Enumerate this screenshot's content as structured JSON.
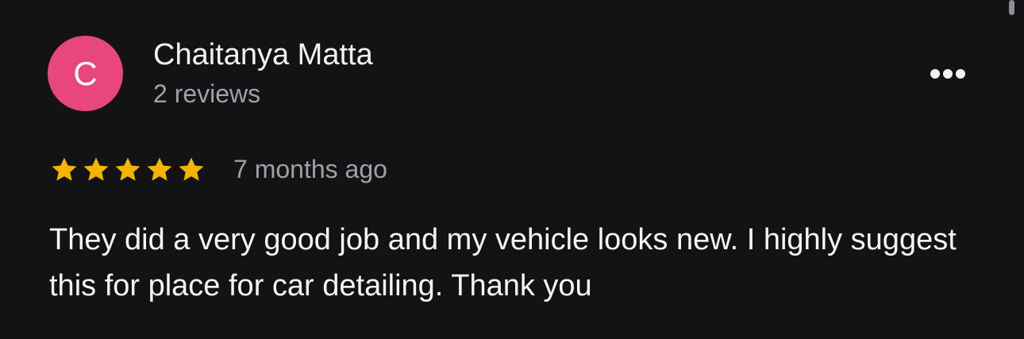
{
  "review": {
    "avatar_initial": "C",
    "author_name": "Chaitanya Matta",
    "author_review_count": "2 reviews",
    "rating": 5,
    "rating_max": 5,
    "timestamp": "7 months ago",
    "text": "They did a very good job and my vehicle looks new. I highly suggest this for place for car detailing. Thank you"
  },
  "colors": {
    "background": "#131315",
    "avatar": "#e8467c",
    "star": "#f4b400",
    "primary_text": "#ffffff",
    "secondary_text": "#a0a0a5"
  },
  "icons": {
    "more": "more-horizontal-icon",
    "star": "star-icon"
  }
}
